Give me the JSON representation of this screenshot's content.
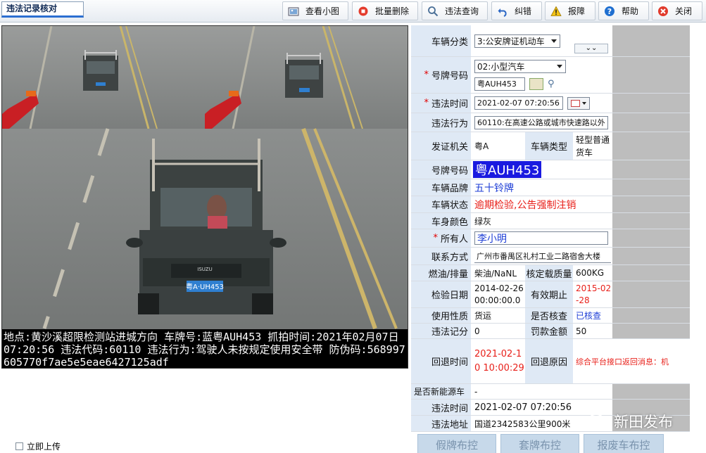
{
  "toolbar": {
    "tab_title": "违法记录核对",
    "buttons": [
      {
        "label": "查看小图",
        "icon": "image-icon"
      },
      {
        "label": "批量删除",
        "icon": "stop-icon"
      },
      {
        "label": "违法查询",
        "icon": "search-icon"
      },
      {
        "label": "纠错",
        "icon": "undo-icon"
      },
      {
        "label": "报障",
        "icon": "warning-icon"
      },
      {
        "label": "帮助",
        "icon": "help-icon"
      },
      {
        "label": "关闭",
        "icon": "close-icon"
      }
    ]
  },
  "photo": {
    "caption": "地点:黄沙溪超限检测站进城方向 车牌号:蓝粤AUH453 抓拍时间:2021年02月07日 07:20:56 违法代码:60110 违法行为:驾驶人未按规定使用安全带 防伪码:568997605770f7ae5e5eae6427125adf",
    "plate_on_vehicle": "粤A·UH453",
    "vehicle_grille_brand": "ISUZU"
  },
  "upload_checkbox_label": "立即上传",
  "form": {
    "vehicle_class": {
      "label": "车辆分类",
      "value": "3:公安牌证机动车"
    },
    "plate_type": {
      "label": "号牌号码",
      "value": "02:小型汽车",
      "plate_input": "粤AUH453"
    },
    "violation_time": {
      "label": "违法时间",
      "value": "2021-02-07  07:20:56"
    },
    "violation_act": {
      "label": "违法行为",
      "value": "60110:在高速公路或城市快速路以外"
    },
    "issuing_office": {
      "label": "发证机关",
      "value": "粤A",
      "label2": "车辆类型",
      "value2": "轻型普通货车"
    },
    "plate_number": {
      "label": "号牌号码",
      "value": "粤AUH453"
    },
    "brand": {
      "label": "车辆品牌",
      "value": "五十铃牌"
    },
    "vehicle_status": {
      "label": "车辆状态",
      "value": "逾期检验,公告强制注销"
    },
    "body_color": {
      "label": "车身颜色",
      "value": "绿灰"
    },
    "owner": {
      "label": "所有人",
      "value": "李小明"
    },
    "contact": {
      "label": "联系方式",
      "value": "广州市番禺区礼村工业二路宿舍大楼"
    },
    "fuel": {
      "label": "燃油/排量",
      "value": "柴油/NaNL",
      "label2": "核定载质量",
      "value2": "600KG"
    },
    "inspection": {
      "label": "检验日期",
      "value": "2014-02-26 00:00:00.0",
      "label2": "有效期止",
      "value2": "2015-02-28"
    },
    "usage": {
      "label": "使用性质",
      "value": "货运",
      "label2": "是否核查",
      "value2": "已核查"
    },
    "score": {
      "label": "违法记分",
      "value": "0",
      "label2": "罚款金额",
      "value2": "50"
    },
    "return_time": {
      "label": "回退时间",
      "value": "2021-02-10 10:00:29",
      "label2": "回退原因",
      "value2": "综合平台接口返回消息：机"
    },
    "new_energy": {
      "label": "是否新能源车",
      "value": "-"
    },
    "violation_time2": {
      "label": "违法时间",
      "value": "2021-02-07 07:20:56"
    },
    "location": {
      "label": "违法地址",
      "value": "国道2342583公里900米"
    }
  },
  "bottom_buttons": [
    "假牌布控",
    "套牌布控",
    "报废车布控"
  ],
  "watermark": "新田发布",
  "colors": {
    "label_bg": "#dfe9f5",
    "red_text": "#e8201a",
    "blue_text": "#1f3fd6",
    "plate_highlight": "#1a1ae0"
  }
}
